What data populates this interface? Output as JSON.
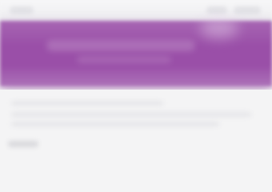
{
  "theme": {
    "background": "#f4f4f5",
    "accent": "#9a4fa8",
    "accent_light": "#ad73b9",
    "placeholder": "#e6e6e9"
  },
  "banner": {
    "heading": "",
    "subheading": ""
  },
  "content": {
    "lines": []
  },
  "footer": {
    "label": ""
  }
}
